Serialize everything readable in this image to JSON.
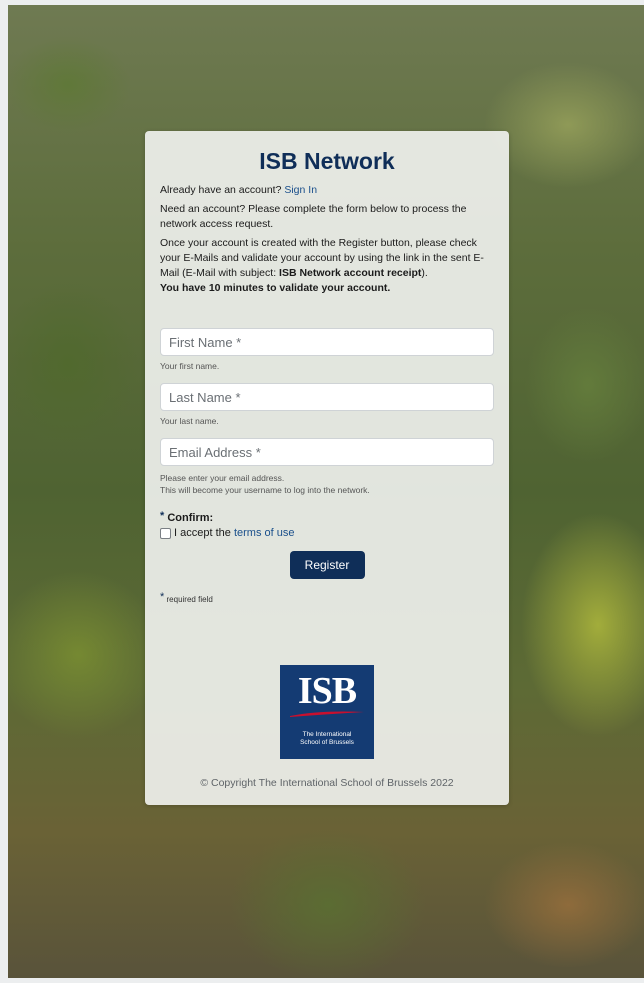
{
  "page": {
    "title": "ISB Network"
  },
  "intro": {
    "have_account_text": "Already have an account?",
    "sign_in_link": "Sign In",
    "need_account_text": "Need an account? Please complete the form below to process the network access request.",
    "instructions_text": "Once your account is created with the Register button, please check your E-Mails and validate your account by using the link in the sent E-Mail (E-Mail with subject:",
    "email_subject": "ISB Network account receipt",
    "instructions_end": ").",
    "validate_warning": "You have 10 minutes to validate your account."
  },
  "form": {
    "first_name": {
      "placeholder": "First Name *",
      "help": "Your first name.",
      "value": ""
    },
    "last_name": {
      "placeholder": "Last Name *",
      "help": "Your last name.",
      "value": ""
    },
    "email": {
      "placeholder": "Email Address *",
      "help_line1": "Please enter your email address.",
      "help_line2": "This will become your username to log into the network.",
      "value": ""
    },
    "confirm_star": "*",
    "confirm_label": "Confirm:",
    "accept_text": "I accept the",
    "terms_link": "terms of use",
    "accept_checked": false,
    "register_label": "Register",
    "required_star": "*",
    "required_note": "required field"
  },
  "logo": {
    "mark": "ISB",
    "sub_line1": "The International",
    "sub_line2": "School of Brussels"
  },
  "footer": {
    "copyright": "© Copyright The International School of Brussels 2022"
  },
  "colors": {
    "brand_navy": "#0f2e58",
    "link": "#1a4f8b",
    "logo_bg": "#143b73",
    "logo_swoosh": "#c8102e"
  }
}
